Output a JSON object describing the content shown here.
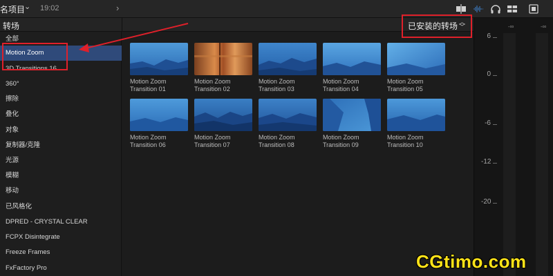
{
  "topbar": {
    "project_name": "名项目",
    "timecode": "19:02"
  },
  "header": {
    "title": "转场",
    "filter_label": "已安装的转场"
  },
  "sidebar": {
    "items": [
      {
        "label": "全部"
      },
      {
        "label": "Motion Zoom"
      },
      {
        "label": "3D Transitions 16"
      },
      {
        "label": "360°"
      },
      {
        "label": "擦除"
      },
      {
        "label": "叠化"
      },
      {
        "label": "对象"
      },
      {
        "label": "复制器/克隆"
      },
      {
        "label": "光源"
      },
      {
        "label": "模糊"
      },
      {
        "label": "移动"
      },
      {
        "label": "已风格化"
      },
      {
        "label": "DPRED - CRYSTAL CLEAR"
      },
      {
        "label": "FCPX Disintegrate"
      },
      {
        "label": "Freeze Frames"
      },
      {
        "label": "FxFactory Pro"
      }
    ],
    "selected_index": 1
  },
  "browser": {
    "tiles": [
      {
        "line1": "Motion Zoom",
        "line2": "Transition 01"
      },
      {
        "line1": "Motion Zoom",
        "line2": "Transition 02"
      },
      {
        "line1": "Motion Zoom",
        "line2": "Transition 03"
      },
      {
        "line1": "Motion Zoom",
        "line2": "Transition 04"
      },
      {
        "line1": "Motion Zoom",
        "line2": "Transition 05"
      },
      {
        "line1": "Motion Zoom",
        "line2": "Transition 06"
      },
      {
        "line1": "Motion Zoom",
        "line2": "Transition 07"
      },
      {
        "line1": "Motion Zoom",
        "line2": "Transition 08"
      },
      {
        "line1": "Motion Zoom",
        "line2": "Transition 09"
      },
      {
        "line1": "Motion Zoom",
        "line2": "Transition 10"
      }
    ]
  },
  "meter": {
    "header_left": "-∞",
    "header_right": "-∞",
    "scale": [
      "6",
      "0",
      "-6",
      "-12",
      "-20"
    ]
  },
  "watermark": "CGtimo.com",
  "colors": {
    "selection": "#2f4a7a",
    "annotation_red": "#e0202a",
    "watermark_yellow": "#ffe318",
    "thumb_blue": "#3a7fc4",
    "thumb_copper": "#b8642e"
  }
}
